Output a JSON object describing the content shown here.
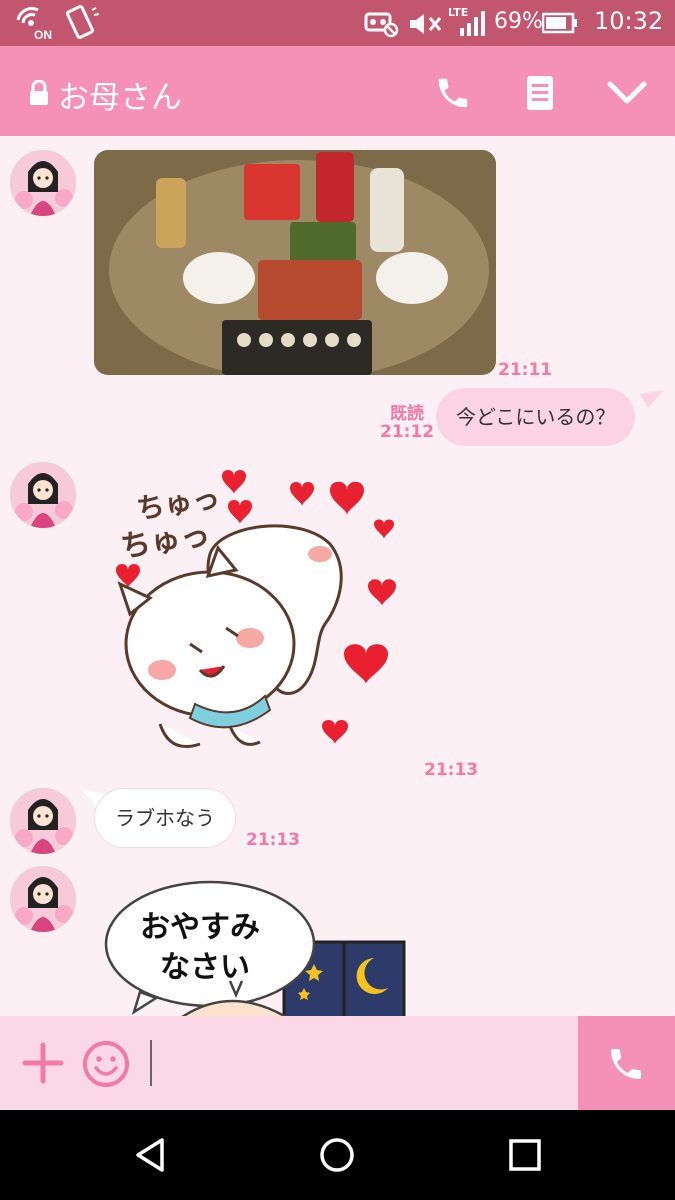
{
  "status_bar": {
    "battery": "69%",
    "time": "10:32",
    "lte": "LTE"
  },
  "header": {
    "title": "お母さん"
  },
  "messages": {
    "photo_time": "21:11",
    "read_label": "既読",
    "my_time": "21:12",
    "my_text": "今どこにいるの？",
    "sticker1_time": "21:13",
    "sticker1_text1": "ちゅっ",
    "sticker1_text2": "ちゅっ",
    "text_msg": "ラブホなう",
    "text_time": "21:13",
    "sticker2_line1": "おやすみ",
    "sticker2_line2": "なさい"
  },
  "colors": {
    "header": "#f591b4",
    "statusbar": "#c2566f",
    "accent": "#f27aa5",
    "background": "#fdf0f4"
  }
}
